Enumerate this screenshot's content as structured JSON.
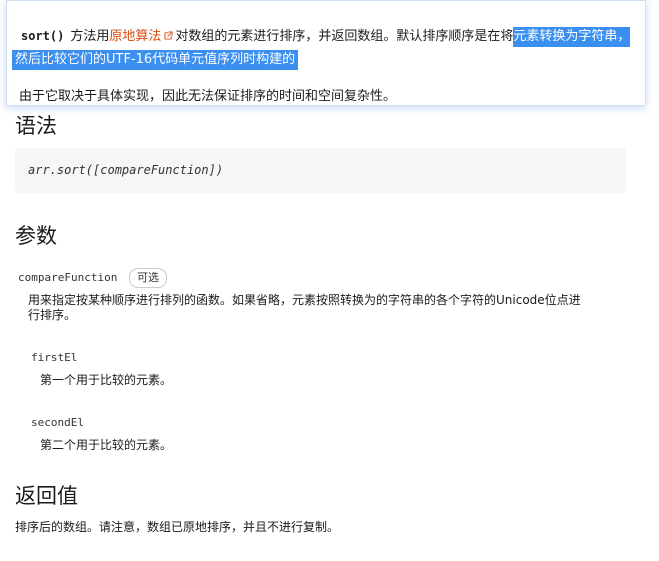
{
  "popup": {
    "method": "sort()",
    "line1_before_link": "方法用",
    "link_text": "原地算法",
    "ext_icon": "external-link-icon",
    "line1_after_link": "对数组的元素进行排序，并返回数组。默认排序顺序是在将",
    "line1_highlight": "元素转换为字符串，",
    "line2_highlight": "然后比较它们的UTF-16代码单元值序列时构建的",
    "line3": "由于它取决于具体实现，因此无法保证排序的时间和空间复杂性。",
    "highlight_color": "#3b8ff0",
    "link_color": "#d94c0f"
  },
  "syntax": {
    "heading": "语法",
    "code": "arr.sort([compareFunction])"
  },
  "params": {
    "heading": "参数",
    "compare_name": "compareFunction",
    "optional_badge": "可选",
    "compare_desc_line1": "用来指定按某种顺序进行排列的函数。如果省略，元素按照转换为的字符串的各个字符的Unicode位点进",
    "compare_desc_line2": "行排序。",
    "first_name": "firstEl",
    "first_desc": "第一个用于比较的元素。",
    "second_name": "secondEl",
    "second_desc": "第二个用于比较的元素。"
  },
  "returns": {
    "heading": "返回值",
    "desc": "排序后的数组。请注意，数组已原地排序，并且不进行复制。"
  }
}
